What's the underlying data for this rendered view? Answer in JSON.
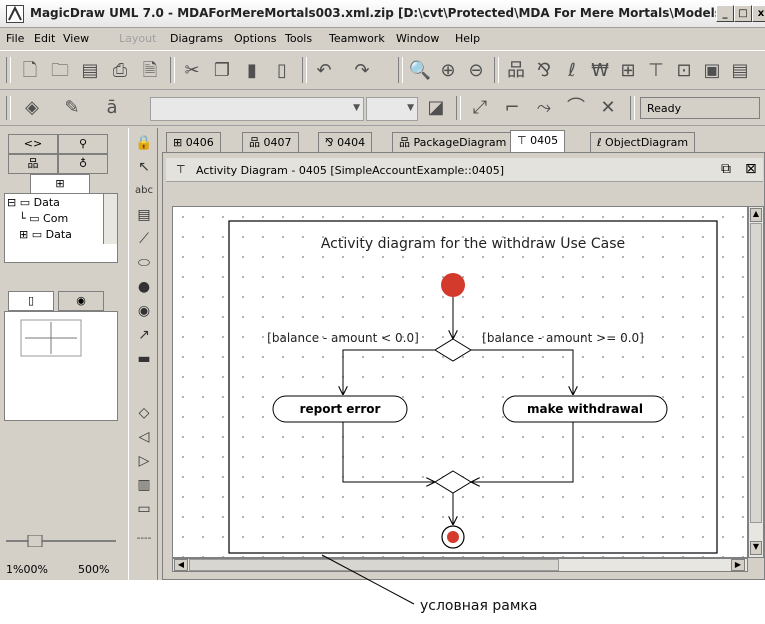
{
  "window": {
    "title": "MagicDraw UML 7.0 - MDAForMereMortals003.xml.zip [D:\\cvt\\Protected\\MDA For Mere Mortals\\Models\\]",
    "min_label": "_",
    "max_label": "□",
    "close_label": "x"
  },
  "menu": [
    "File",
    "Edit",
    "View",
    "Layout",
    "Diagrams",
    "Options",
    "Tools",
    "Teamwork",
    "Window",
    "Help"
  ],
  "status": "Ready",
  "left_panel": {
    "top_tabs": [
      "<>",
      "ĝ4"
    ],
    "tree_items": [
      "Data",
      "Com",
      "Data"
    ],
    "zoom_value": "1%00%",
    "zoom_max": "500%"
  },
  "tabs": [
    "0406",
    "0407",
    "0404",
    "PackageDiagram",
    "0405",
    "ObjectDiagram"
  ],
  "active_tab": "0405",
  "diagram_window": {
    "title": "Activity Diagram - 0405 [SimpleAccountExample::0405]"
  },
  "diagram": {
    "frame_title": "Activity diagram for the withdraw Use Case",
    "guard_left": "[balance - amount < 0.0]",
    "guard_right": "[balance - amount >= 0.0]",
    "action_left": "report error",
    "action_right": "make withdrawal",
    "initial_color": "#d33a2c",
    "final_color": "#d33a2c"
  },
  "annotation": "условная рамка"
}
